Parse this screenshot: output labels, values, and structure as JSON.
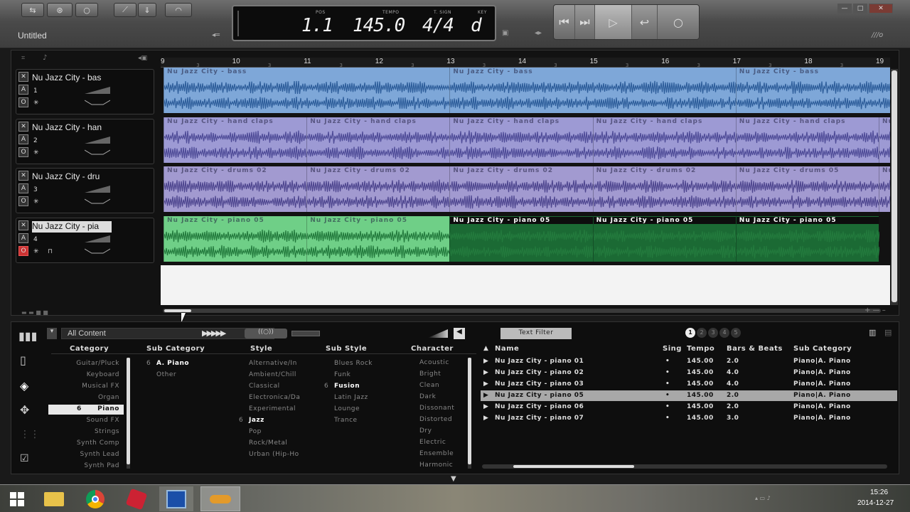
{
  "song": {
    "title": "Untitled"
  },
  "lcd": {
    "pos_label": "POS",
    "pos_value": "1.1",
    "tempo_label": "TEMPO",
    "tempo_value": "145.0",
    "tsig_label": "T. SIGN",
    "tsig_value": "4/4",
    "key_label": "KEY",
    "key_value": "d"
  },
  "ruler": {
    "bars": [
      "9",
      "10",
      "11",
      "12",
      "13",
      "14",
      "15",
      "16",
      "17",
      "18",
      "19"
    ]
  },
  "tracks": [
    {
      "name": "Nu Jazz City - bas",
      "num": "1",
      "color": "#7ea7d8",
      "dark": "#2d5d9a",
      "clips": [
        {
          "label": "Nu Jazz City - bass",
          "start": 0,
          "len": 4
        },
        {
          "label": "Nu Jazz City - bass",
          "start": 4,
          "len": 4
        },
        {
          "label": "Nu Jazz City - bass",
          "start": 8,
          "len": 2.2
        }
      ]
    },
    {
      "name": "Nu Jazz City - han",
      "num": "2",
      "color": "#9d9ad4",
      "dark": "#4e4b97",
      "clips": [
        {
          "label": "Nu Jazz City - hand claps",
          "start": 0,
          "len": 2
        },
        {
          "label": "Nu Jazz City - hand claps",
          "start": 2,
          "len": 2
        },
        {
          "label": "Nu Jazz City - hand claps",
          "start": 4,
          "len": 2
        },
        {
          "label": "Nu Jazz City - hand claps",
          "start": 6,
          "len": 2
        },
        {
          "label": "Nu Jazz City - hand claps",
          "start": 8,
          "len": 2
        },
        {
          "label": "Nu",
          "start": 10,
          "len": 0.2
        }
      ]
    },
    {
      "name": "Nu Jazz City - dru",
      "num": "3",
      "color": "#a29ad0",
      "dark": "#4e468f",
      "clips": [
        {
          "label": "Nu Jazz City - drums 02",
          "start": 0,
          "len": 2
        },
        {
          "label": "Nu Jazz City - drums 02",
          "start": 2,
          "len": 2
        },
        {
          "label": "Nu Jazz City - drums 02",
          "start": 4,
          "len": 2
        },
        {
          "label": "Nu Jazz City - drums 02",
          "start": 6,
          "len": 2
        },
        {
          "label": "Nu Jazz City - drums 05",
          "start": 8,
          "len": 2
        },
        {
          "label": "Nu",
          "start": 10,
          "len": 0.2
        }
      ]
    },
    {
      "name": "Nu Jazz City - pia",
      "num": "4",
      "color": "#6fcf87",
      "dark": "#237a3d",
      "clips": [
        {
          "label": "Nu Jazz City - piano 05",
          "start": 0,
          "len": 2,
          "sel": false
        },
        {
          "label": "Nu Jazz City - piano 05",
          "start": 2,
          "len": 2,
          "sel": false
        },
        {
          "label": "Nu Jazz City - piano 05",
          "start": 4,
          "len": 2,
          "sel": true
        },
        {
          "label": "Nu Jazz City - piano 05",
          "start": 6,
          "len": 2,
          "sel": true
        },
        {
          "label": "Nu Jazz City - piano 05",
          "start": 8,
          "len": 2,
          "sel": true
        }
      ]
    }
  ],
  "browser": {
    "content_label": "All Content",
    "text_filter": "Text Filter",
    "pages": [
      "1",
      "2",
      "3",
      "4",
      "5"
    ],
    "headers": {
      "category": "Category",
      "subcategory": "Sub Category",
      "style": "Style",
      "substyle": "Sub Style",
      "character": "Character"
    },
    "categories": [
      {
        "n": "",
        "t": "Guitar/Pluck"
      },
      {
        "n": "",
        "t": "Keyboard"
      },
      {
        "n": "",
        "t": "Musical FX"
      },
      {
        "n": "",
        "t": "Organ"
      },
      {
        "n": "6",
        "t": "Piano",
        "sel": true
      },
      {
        "n": "",
        "t": "Sound FX"
      },
      {
        "n": "",
        "t": "Strings"
      },
      {
        "n": "",
        "t": "Synth Comp"
      },
      {
        "n": "",
        "t": "Synth Lead"
      },
      {
        "n": "",
        "t": "Synth Pad"
      }
    ],
    "subcategories": [
      {
        "n": "6",
        "t": "A. Piano",
        "hl": true
      },
      {
        "n": "",
        "t": "Other"
      }
    ],
    "styles": [
      {
        "n": "",
        "t": "Alternative/In"
      },
      {
        "n": "",
        "t": "Ambient/Chill"
      },
      {
        "n": "",
        "t": "Classical"
      },
      {
        "n": "",
        "t": "Electronica/Da"
      },
      {
        "n": "",
        "t": "Experimental"
      },
      {
        "n": "6",
        "t": "Jazz",
        "hl": true
      },
      {
        "n": "",
        "t": "Pop"
      },
      {
        "n": "",
        "t": "Rock/Metal"
      },
      {
        "n": "",
        "t": "Urban (Hip-Ho"
      }
    ],
    "substyles": [
      {
        "n": "",
        "t": "Blues Rock"
      },
      {
        "n": "",
        "t": "Funk"
      },
      {
        "n": "6",
        "t": "Fusion",
        "hl": true
      },
      {
        "n": "",
        "t": "Latin Jazz"
      },
      {
        "n": "",
        "t": "Lounge"
      },
      {
        "n": "",
        "t": "Trance"
      }
    ],
    "characters": [
      "Acoustic",
      "Bright",
      "Clean",
      "Dark",
      "Dissonant",
      "Distorted",
      "Dry",
      "Electric",
      "Ensemble",
      "Harmonic"
    ],
    "result_headers": {
      "name": "Name",
      "sing": "Sing",
      "tempo": "Tempo",
      "bars": "Bars & Beats",
      "subcat": "Sub Category"
    },
    "results": [
      {
        "name": "Nu Jazz City - piano 01",
        "sing": "•",
        "tempo": "145.00",
        "bars": "2.0",
        "subcat": "Piano|A. Piano"
      },
      {
        "name": "Nu Jazz City - piano 02",
        "sing": "•",
        "tempo": "145.00",
        "bars": "4.0",
        "subcat": "Piano|A. Piano"
      },
      {
        "name": "Nu Jazz City - piano 03",
        "sing": "•",
        "tempo": "145.00",
        "bars": "4.0",
        "subcat": "Piano|A. Piano"
      },
      {
        "name": "Nu Jazz City - piano 05",
        "sing": "•",
        "tempo": "145.00",
        "bars": "2.0",
        "subcat": "Piano|A. Piano",
        "sel": true
      },
      {
        "name": "Nu Jazz City - piano 06",
        "sing": "•",
        "tempo": "145.00",
        "bars": "2.0",
        "subcat": "Piano|A. Piano"
      },
      {
        "name": "Nu Jazz City - piano 07",
        "sing": "•",
        "tempo": "145.00",
        "bars": "3.0",
        "subcat": "Piano|A. Piano"
      }
    ]
  },
  "taskbar": {
    "time": "15:26",
    "date": "2014-12-27",
    "apps": [
      "start-icon",
      "file-explorer-icon",
      "chrome-icon",
      "paint-icon",
      "app-icon",
      "studio-icon"
    ]
  }
}
